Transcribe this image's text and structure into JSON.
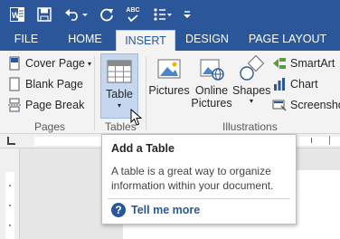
{
  "quick_access": {
    "word_icon": "word-app-icon",
    "save_icon": "save-icon",
    "undo_icon": "undo-icon",
    "redo_icon": "redo-icon",
    "spelling_icon": "spelling-abc-icon",
    "spelling_label": "ABC",
    "bullets_icon": "bullets-icon",
    "customize_icon": "customize-qat-icon"
  },
  "tabs": [
    {
      "label": "FILE"
    },
    {
      "label": "HOME"
    },
    {
      "label": "INSERT",
      "active": true
    },
    {
      "label": "DESIGN"
    },
    {
      "label": "PAGE LAYOUT"
    }
  ],
  "ribbon": {
    "pages_group": {
      "label": "Pages",
      "cover_page": "Cover Page",
      "blank_page": "Blank Page",
      "page_break": "Page Break"
    },
    "tables_group": {
      "label": "Tables",
      "table": "Table"
    },
    "illustrations_group": {
      "label": "Illustrations",
      "pictures": "Pictures",
      "online_pictures_1": "Online",
      "online_pictures_2": "Pictures",
      "shapes": "Shapes",
      "smartart": "SmartArt",
      "chart": "Chart",
      "screenshot": "Screenshot"
    }
  },
  "tooltip": {
    "title": "Add a Table",
    "body": "A table is a great way to organize information within your document.",
    "help_label": "Tell me more"
  },
  "colors": {
    "accent": "#2b579a",
    "ribbon_bg": "#f3f3f3",
    "table_highlight": "#c5d7ef"
  }
}
